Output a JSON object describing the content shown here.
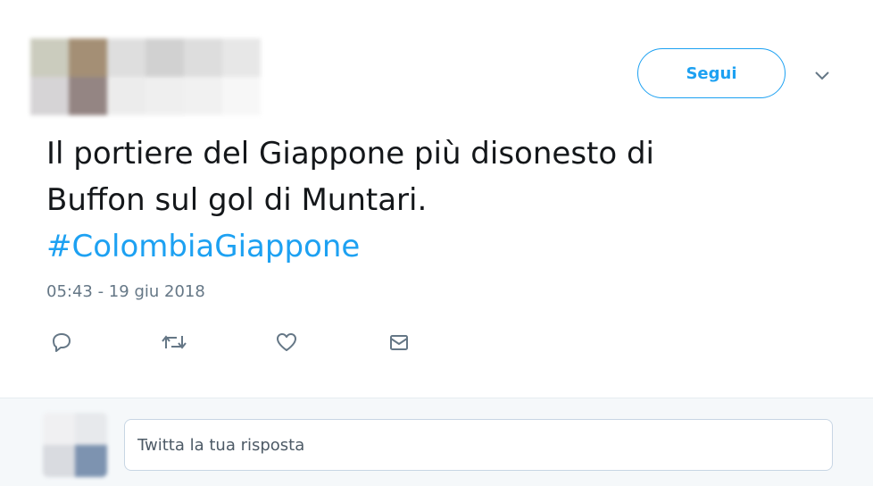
{
  "colors": {
    "accent": "#1da1f2",
    "text": "#14171a",
    "muted": "#657786",
    "reply_bg": "#f5f8fa"
  },
  "header": {
    "follow_label": "Segui",
    "more_icon": "chevron-down-icon"
  },
  "tweet": {
    "text_line_1": "Il portiere del Giappone più disonesto di",
    "text_line_2": "Buffon sul gol di Muntari.",
    "hashtag": "#ColombiaGiappone",
    "timestamp": "05:43 - 19 giu 2018"
  },
  "actions": [
    {
      "name": "reply",
      "icon": "reply-icon"
    },
    {
      "name": "retweet",
      "icon": "retweet-icon"
    },
    {
      "name": "like",
      "icon": "heart-icon"
    },
    {
      "name": "message",
      "icon": "envelope-icon"
    }
  ],
  "reply": {
    "placeholder": "Twitta la tua risposta"
  }
}
